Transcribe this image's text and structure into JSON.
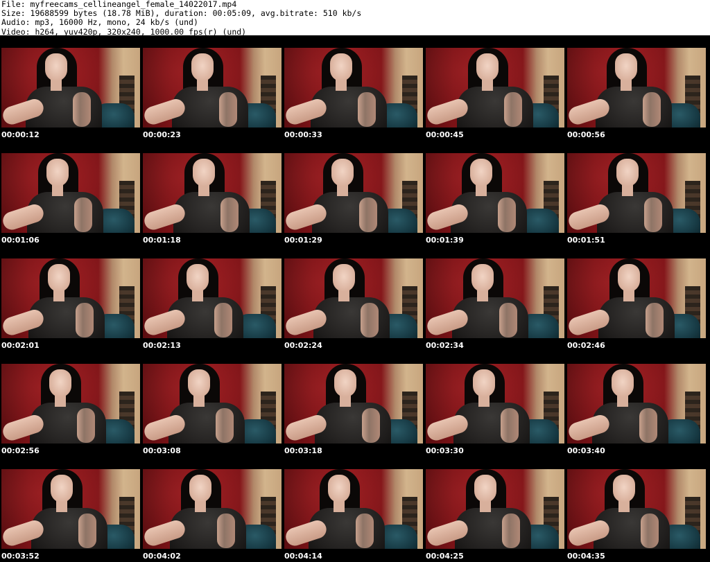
{
  "header": {
    "file_line": "File: myfreecams_cellineangel_female_14022017.mp4",
    "size_line": "Size: 19688599 bytes (18.78 MiB), duration: 00:05:09, avg.bitrate: 510 kb/s",
    "audio_line": "Audio: mp3, 16000 Hz, mono, 24 kb/s (und)",
    "video_line": "Video: h264, yuv420p, 320x240, 1000.00 fps(r) (und)"
  },
  "thumbnails": [
    {
      "timestamp": "00:00:12"
    },
    {
      "timestamp": "00:00:23"
    },
    {
      "timestamp": "00:00:33"
    },
    {
      "timestamp": "00:00:45"
    },
    {
      "timestamp": "00:00:56"
    },
    {
      "timestamp": "00:01:06"
    },
    {
      "timestamp": "00:01:18"
    },
    {
      "timestamp": "00:01:29"
    },
    {
      "timestamp": "00:01:39"
    },
    {
      "timestamp": "00:01:51"
    },
    {
      "timestamp": "00:02:01"
    },
    {
      "timestamp": "00:02:13"
    },
    {
      "timestamp": "00:02:24"
    },
    {
      "timestamp": "00:02:34"
    },
    {
      "timestamp": "00:02:46"
    },
    {
      "timestamp": "00:02:56"
    },
    {
      "timestamp": "00:03:08"
    },
    {
      "timestamp": "00:03:18"
    },
    {
      "timestamp": "00:03:30"
    },
    {
      "timestamp": "00:03:40"
    },
    {
      "timestamp": "00:03:52"
    },
    {
      "timestamp": "00:04:02"
    },
    {
      "timestamp": "00:04:14"
    },
    {
      "timestamp": "00:04:25"
    },
    {
      "timestamp": "00:04:35"
    }
  ],
  "colors": {
    "grid_background": "#000000",
    "label_color": "#ffffff",
    "page_background": "#ffffff"
  }
}
